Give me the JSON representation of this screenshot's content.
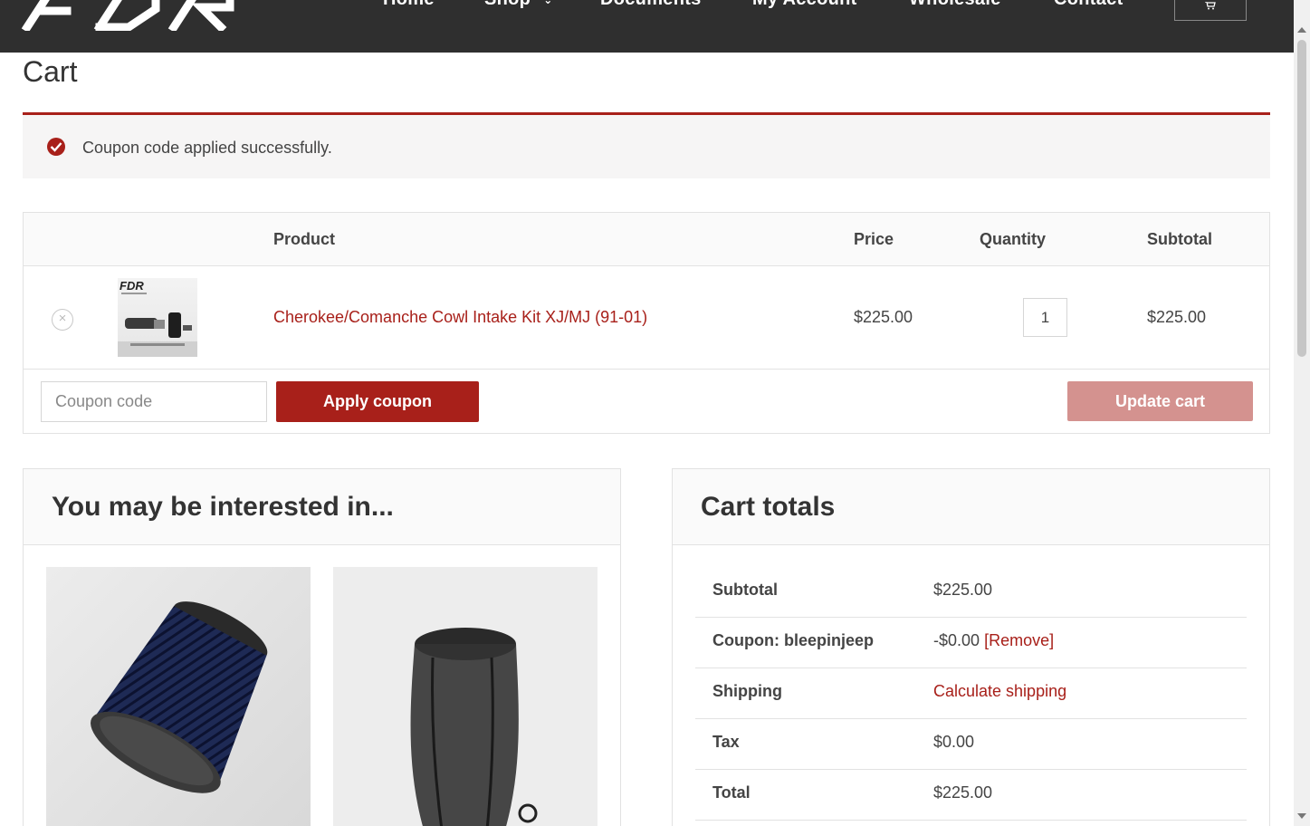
{
  "header": {
    "nav": [
      {
        "label": "Home"
      },
      {
        "label": "Shop"
      },
      {
        "label": "Documents"
      },
      {
        "label": "My Account"
      },
      {
        "label": "Wholesale"
      },
      {
        "label": "Contact"
      }
    ],
    "cart_icon": "cart-icon",
    "logo_text": "FDR"
  },
  "page": {
    "title": "Cart"
  },
  "notice": {
    "message": "Coupon code applied successfully.",
    "icon": "check-circle-icon",
    "color": "#a8201a"
  },
  "cart_table": {
    "headers": {
      "product": "Product",
      "price": "Price",
      "quantity": "Quantity",
      "subtotal": "Subtotal"
    },
    "items": [
      {
        "name": "Cherokee/Comanche Cowl Intake Kit XJ/MJ (91-01)",
        "price": "$225.00",
        "quantity": "1",
        "subtotal": "$225.00"
      }
    ],
    "coupon_placeholder": "Coupon code",
    "apply_label": "Apply coupon",
    "update_label": "Update cart"
  },
  "interested": {
    "title": "You may be interested in..."
  },
  "totals": {
    "title": "Cart totals",
    "subtotal_label": "Subtotal",
    "subtotal_value": "$225.00",
    "coupon_label": "Coupon: bleepinjeep",
    "coupon_value": "-$0.00",
    "coupon_remove": "[Remove]",
    "shipping_label": "Shipping",
    "shipping_value": "Calculate shipping",
    "tax_label": "Tax",
    "tax_value": "$0.00",
    "total_label": "Total",
    "total_value": "$225.00"
  },
  "colors": {
    "accent": "#a8201a",
    "header_bg": "#2f2f2f",
    "update_disabled": "#d4928f"
  }
}
